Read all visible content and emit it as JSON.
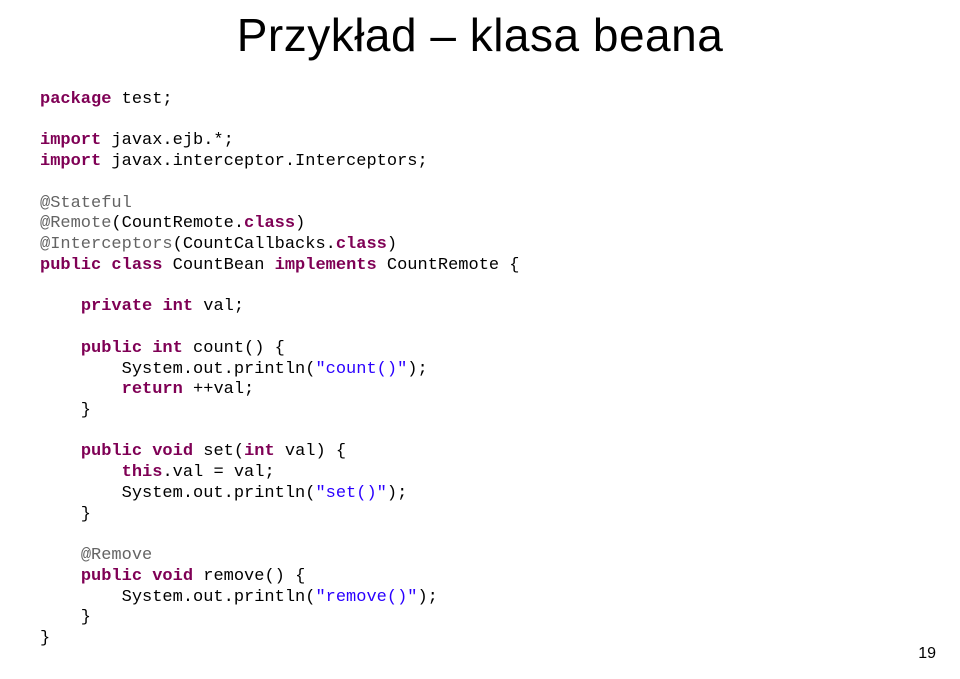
{
  "title": "Przykład – klasa beana",
  "pagenum": "19",
  "code": {
    "l01a": "package",
    "l01b": " test;",
    "l02": "",
    "l03a": "import",
    "l03b": " javax.ejb.*;",
    "l04a": "import",
    "l04b": " javax.interceptor.Interceptors;",
    "l05": "",
    "l06": "@Stateful",
    "l07a": "@Remote",
    "l07b": "(CountRemote.",
    "l07c": "class",
    "l07d": ")",
    "l08a": "@Interceptors",
    "l08b": "(CountCallbacks.",
    "l08c": "class",
    "l08d": ")",
    "l09a": "public",
    "l09b": " ",
    "l09c": "class",
    "l09d": " CountBean ",
    "l09e": "implements",
    "l09f": " CountRemote {",
    "l10": "",
    "l11a": "    ",
    "l11b": "private",
    "l11c": " ",
    "l11d": "int",
    "l11e": " val;",
    "l12": "",
    "l13a": "    ",
    "l13b": "public",
    "l13c": " ",
    "l13d": "int",
    "l13e": " count() {",
    "l14a": "        System.out.println(",
    "l14b": "\"count()\"",
    "l14c": ");",
    "l15a": "        ",
    "l15b": "return",
    "l15c": " ++val;",
    "l16": "    }",
    "l17": "",
    "l18a": "    ",
    "l18b": "public",
    "l18c": " ",
    "l18d": "void",
    "l18e": " set(",
    "l18f": "int",
    "l18g": " val) {",
    "l19a": "        ",
    "l19b": "this",
    "l19c": ".val = val;",
    "l20a": "        System.out.println(",
    "l20b": "\"set()\"",
    "l20c": ");",
    "l21": "    }",
    "l22": "",
    "l23a": "    ",
    "l23b": "@Remove",
    "l24a": "    ",
    "l24b": "public",
    "l24c": " ",
    "l24d": "void",
    "l24e": " remove() {",
    "l25a": "        System.out.println(",
    "l25b": "\"remove()\"",
    "l25c": ");",
    "l26": "    }",
    "l27": "}"
  }
}
